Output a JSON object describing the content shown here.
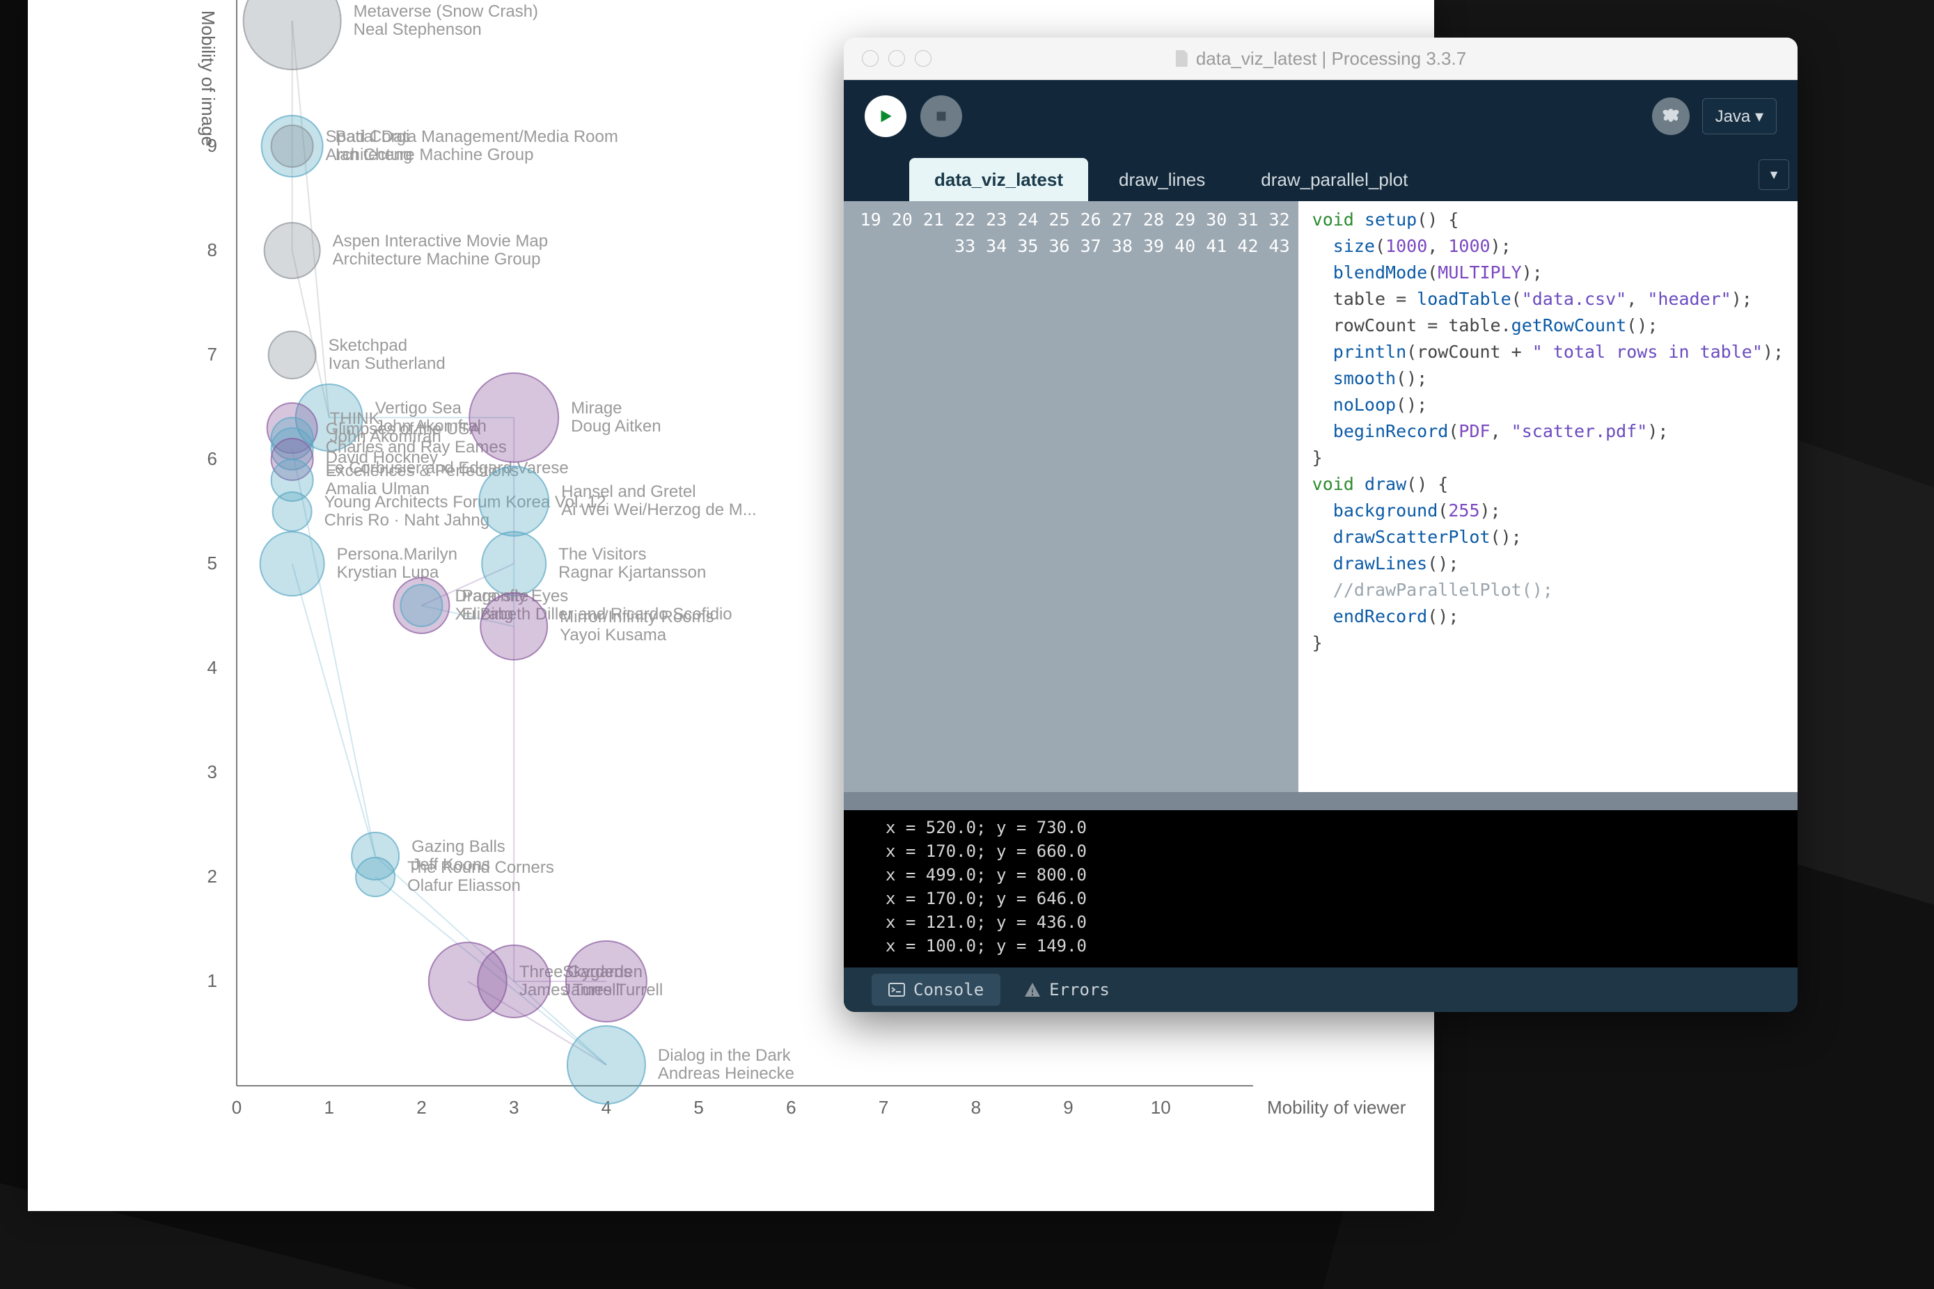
{
  "ide": {
    "title": "data_viz_latest | Processing 3.3.7",
    "mode": "Java ▾",
    "tabs": [
      "data_viz_latest",
      "draw_lines",
      "draw_parallel_plot"
    ],
    "activeTab": 0,
    "gutterStart": 19,
    "gutterEnd": 43,
    "highlightLine": 43,
    "code": [
      [
        [
          "kw",
          "void"
        ],
        [
          "op",
          " "
        ],
        [
          "fn",
          "setup"
        ],
        [
          "op",
          "() {"
        ]
      ],
      [],
      [
        [
          "op",
          "  "
        ],
        [
          "fn",
          "size"
        ],
        [
          "op",
          "("
        ],
        [
          "lit",
          "1000"
        ],
        [
          "op",
          ", "
        ],
        [
          "lit",
          "1000"
        ],
        [
          "op",
          ");"
        ]
      ],
      [
        [
          "op",
          "  "
        ],
        [
          "fn",
          "blendMode"
        ],
        [
          "op",
          "("
        ],
        [
          "lit",
          "MULTIPLY"
        ],
        [
          "op",
          ");"
        ]
      ],
      [],
      [
        [
          "op",
          "  table = "
        ],
        [
          "fn",
          "loadTable"
        ],
        [
          "op",
          "("
        ],
        [
          "str",
          "\"data.csv\""
        ],
        [
          "op",
          ", "
        ],
        [
          "str",
          "\"header\""
        ],
        [
          "op",
          ");"
        ]
      ],
      [
        [
          "op",
          "  rowCount = table."
        ],
        [
          "fn",
          "getRowCount"
        ],
        [
          "op",
          "();"
        ]
      ],
      [
        [
          "op",
          "  "
        ],
        [
          "fn",
          "println"
        ],
        [
          "op",
          "(rowCount + "
        ],
        [
          "str",
          "\" total rows in table\""
        ],
        [
          "op",
          ");"
        ]
      ],
      [],
      [
        [
          "op",
          "  "
        ],
        [
          "fn",
          "smooth"
        ],
        [
          "op",
          "();"
        ]
      ],
      [],
      [
        [
          "op",
          "  "
        ],
        [
          "fn",
          "noLoop"
        ],
        [
          "op",
          "();"
        ]
      ],
      [
        [
          "op",
          "  "
        ],
        [
          "fn",
          "beginRecord"
        ],
        [
          "op",
          "("
        ],
        [
          "lit",
          "PDF"
        ],
        [
          "op",
          ", "
        ],
        [
          "str",
          "\"scatter.pdf\""
        ],
        [
          "op",
          ");"
        ]
      ],
      [
        [
          "op",
          "}"
        ]
      ],
      [],
      [
        [
          "kw",
          "void"
        ],
        [
          "op",
          " "
        ],
        [
          "fn",
          "draw"
        ],
        [
          "op",
          "() {"
        ]
      ],
      [
        [
          "op",
          "  "
        ],
        [
          "fn",
          "background"
        ],
        [
          "op",
          "("
        ],
        [
          "lit",
          "255"
        ],
        [
          "op",
          ");"
        ]
      ],
      [],
      [
        [
          "op",
          "  "
        ],
        [
          "fn",
          "drawScatterPlot"
        ],
        [
          "op",
          "();"
        ]
      ],
      [
        [
          "op",
          "  "
        ],
        [
          "fn",
          "drawLines"
        ],
        [
          "op",
          "();"
        ]
      ],
      [],
      [
        [
          "op",
          "  "
        ],
        [
          "com",
          "//drawParallelPlot();"
        ]
      ],
      [],
      [
        [
          "op",
          "  "
        ],
        [
          "fn",
          "endRecord"
        ],
        [
          "op",
          "();"
        ]
      ],
      [
        [
          "op",
          "}"
        ]
      ]
    ],
    "console": [
      "x = 520.0; y = 730.0",
      "x = 170.0; y = 660.0",
      "x = 499.0; y = 800.0",
      "x = 170.0; y = 646.0",
      "x = 121.0; y = 436.0",
      "x = 100.0; y = 149.0"
    ],
    "consoleTabs": {
      "active": "Console",
      "items": [
        "Console",
        "Errors"
      ]
    }
  },
  "chart_data": {
    "type": "scatter",
    "xlabel": "Mobility of viewer",
    "ylabel": "Mobility of image",
    "xlim": [
      0,
      11
    ],
    "ylim": [
      0,
      10
    ],
    "xticks": [
      0,
      1,
      2,
      3,
      4,
      5,
      6,
      7,
      8,
      9,
      10
    ],
    "yticks": [
      1,
      2,
      3,
      4,
      5,
      6,
      7,
      8,
      9
    ],
    "colors": {
      "blue": "#5aa8c4",
      "purple": "#8a5a9e",
      "grey": "#8a9298"
    },
    "points": [
      {
        "x": 0.6,
        "y": 10.2,
        "r": 70,
        "c": "grey",
        "title": "Metaverse (Snow Crash)",
        "artist": "Neal Stephenson"
      },
      {
        "x": 0.6,
        "y": 9.0,
        "r": 44,
        "c": "blue",
        "title": "Bad Corgi",
        "artist": "Ian Cheng"
      },
      {
        "x": 0.6,
        "y": 9.0,
        "r": 30,
        "c": "grey",
        "title": "Spatial Data Management/Media Room",
        "artist": "Architecture Machine Group"
      },
      {
        "x": 0.6,
        "y": 8.0,
        "r": 40,
        "c": "grey",
        "title": "Aspen Interactive Movie Map",
        "artist": "Architecture Machine Group"
      },
      {
        "x": 0.6,
        "y": 7.0,
        "r": 34,
        "c": "grey",
        "title": "Sketchpad",
        "artist": "Ivan Sutherland"
      },
      {
        "x": 1.0,
        "y": 6.4,
        "r": 48,
        "c": "blue",
        "title": "Vertigo Sea",
        "artist": "John Akomfrah"
      },
      {
        "x": 0.6,
        "y": 6.3,
        "r": 36,
        "c": "purple",
        "title": "THINK",
        "artist": "John Akomfrah"
      },
      {
        "x": 0.6,
        "y": 6.2,
        "r": 30,
        "c": "blue",
        "title": "Glimpses of the USA",
        "artist": "Charles and Ray Eames"
      },
      {
        "x": 0.6,
        "y": 6.1,
        "r": 30,
        "c": "blue",
        "title": "",
        "artist": "David Hockney"
      },
      {
        "x": 0.6,
        "y": 6.0,
        "r": 30,
        "c": "purple",
        "title": "",
        "artist": "Le Corbusier and Edgard Varese"
      },
      {
        "x": 0.6,
        "y": 5.8,
        "r": 30,
        "c": "blue",
        "title": "Excellences & Perfections",
        "artist": "Amalia Ulman"
      },
      {
        "x": 0.6,
        "y": 5.5,
        "r": 28,
        "c": "blue",
        "title": "Young Architects Forum Korea Vol. 12",
        "artist": "Chris Ro · Naht Jahng"
      },
      {
        "x": 0.6,
        "y": 5.0,
        "r": 46,
        "c": "blue",
        "title": "Persona.Marilyn",
        "artist": "Krystian Lupa"
      },
      {
        "x": 3.0,
        "y": 6.4,
        "r": 64,
        "c": "purple",
        "title": "Mirage",
        "artist": "Doug Aitken"
      },
      {
        "x": 3.0,
        "y": 5.6,
        "r": 50,
        "c": "blue",
        "title": "Hansel and Gretel",
        "artist": "Ai Wei Wei/Herzog de M..."
      },
      {
        "x": 3.0,
        "y": 5.0,
        "r": 46,
        "c": "blue",
        "title": "The Visitors",
        "artist": "Ragnar Kjartansson"
      },
      {
        "x": 2.0,
        "y": 4.6,
        "r": 40,
        "c": "purple",
        "title": "Para-site",
        "artist": "Elizabeth Diller and Ricardo Scofidio"
      },
      {
        "x": 2.0,
        "y": 4.6,
        "r": 30,
        "c": "blue",
        "title": "Dragonfly Eyes",
        "artist": "Xu Bing"
      },
      {
        "x": 3.0,
        "y": 4.4,
        "r": 48,
        "c": "purple",
        "title": "Mirror/Infinity Rooms",
        "artist": "Yayoi Kusama"
      },
      {
        "x": 1.5,
        "y": 2.2,
        "r": 34,
        "c": "blue",
        "title": "Gazing Balls",
        "artist": "Jeff Koons"
      },
      {
        "x": 1.5,
        "y": 2.0,
        "r": 28,
        "c": "blue",
        "title": "The Round Corners",
        "artist": "Olafur Eliasson"
      },
      {
        "x": 2.5,
        "y": 1.0,
        "r": 56,
        "c": "purple",
        "title": "Three Gardens",
        "artist": "James Turrell"
      },
      {
        "x": 3.0,
        "y": 1.0,
        "r": 52,
        "c": "purple",
        "title": "Skygarden",
        "artist": "James Turrell"
      },
      {
        "x": 4.0,
        "y": 1.0,
        "r": 58,
        "c": "purple",
        "title": "",
        "artist": ""
      },
      {
        "x": 4.0,
        "y": 0.2,
        "r": 56,
        "c": "blue",
        "title": "Dialog in the Dark",
        "artist": "Andreas Heinecke",
        "faded": true
      }
    ],
    "links": [
      [
        0,
        3
      ],
      [
        0,
        5
      ],
      [
        3,
        5
      ],
      [
        5,
        13
      ],
      [
        13,
        15
      ],
      [
        15,
        18
      ],
      [
        18,
        22
      ],
      [
        22,
        23
      ],
      [
        21,
        24
      ],
      [
        8,
        19
      ],
      [
        12,
        19
      ],
      [
        19,
        24
      ],
      [
        17,
        18
      ],
      [
        16,
        15
      ],
      [
        24,
        20
      ]
    ]
  }
}
